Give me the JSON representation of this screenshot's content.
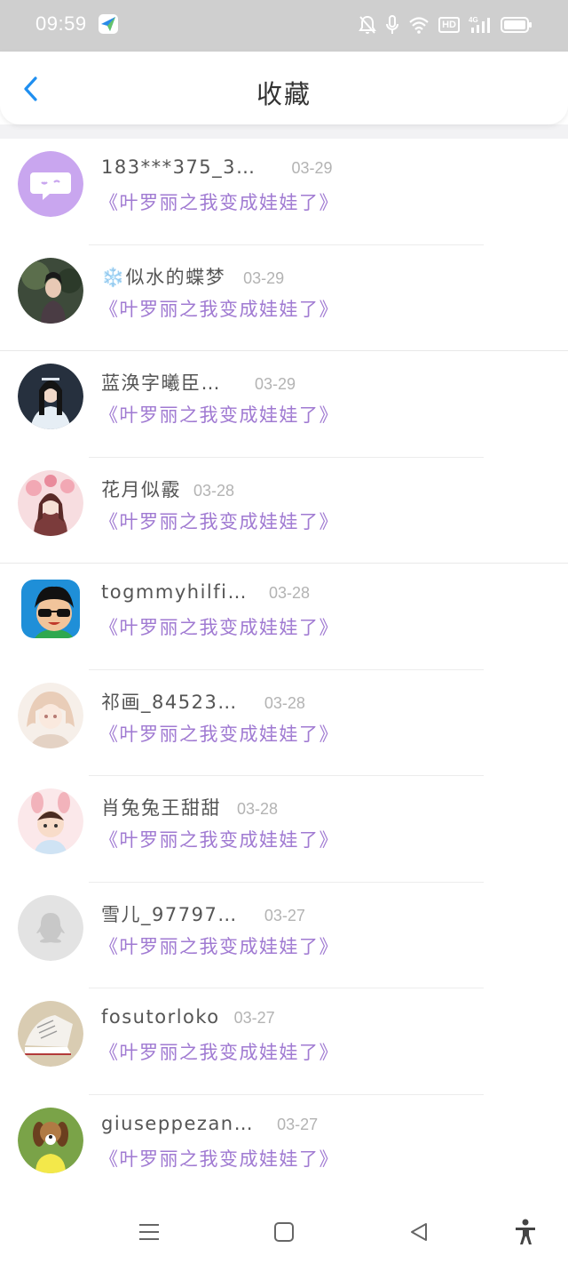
{
  "status_bar": {
    "time": "09:59",
    "hd_label": "HD",
    "network_label": "4G",
    "icons": [
      "app-notification-icon",
      "mute-icon",
      "microphone-icon",
      "wifi-icon",
      "hd-icon",
      "signal-icon",
      "battery-icon"
    ]
  },
  "header": {
    "title": "收藏",
    "back_icon": "chevron-left-icon"
  },
  "colors": {
    "accent_blue": "#1f8ff0",
    "novel_title_purple": "#a07ad2",
    "date_gray": "#b3b3b3",
    "name_gray": "#555555"
  },
  "items": [
    {
      "name": "183***375_3…",
      "date": "03-29",
      "title": "《叶罗丽之我变成娃娃了》",
      "avatar": "chat-bubble-avatar"
    },
    {
      "name": "❄️似水的蝶梦",
      "date": "03-29",
      "title": "《叶罗丽之我变成娃娃了》",
      "avatar": "photo-avatar"
    },
    {
      "name": "蓝涣字曦臣…",
      "date": "03-29",
      "title": "《叶罗丽之我变成娃娃了》",
      "avatar": "photo-avatar"
    },
    {
      "name": "花月似霰",
      "date": "03-28",
      "title": "《叶罗丽之我变成娃娃了》",
      "avatar": "photo-avatar"
    },
    {
      "name": "togmmyhilfi…",
      "date": "03-28",
      "title": "《叶罗丽之我变成娃娃了》",
      "avatar": "cartoon-avatar"
    },
    {
      "name": "祁画_84523…",
      "date": "03-28",
      "title": "《叶罗丽之我变成娃娃了》",
      "avatar": "photo-avatar"
    },
    {
      "name": "肖兔兔王甜甜",
      "date": "03-28",
      "title": "《叶罗丽之我变成娃娃了》",
      "avatar": "photo-avatar"
    },
    {
      "name": "雪儿_97797…",
      "date": "03-27",
      "title": "《叶罗丽之我变成娃娃了》",
      "avatar": "default-avatar"
    },
    {
      "name": "fosutorloko",
      "date": "03-27",
      "title": "《叶罗丽之我变成娃娃了》",
      "avatar": "photo-avatar"
    },
    {
      "name": "giuseppezan…",
      "date": "03-27",
      "title": "《叶罗丽之我变成娃娃了》",
      "avatar": "photo-avatar"
    }
  ],
  "bottom_nav": {
    "icons": [
      "menu-icon",
      "home-icon",
      "back-icon",
      "accessibility-icon"
    ]
  }
}
